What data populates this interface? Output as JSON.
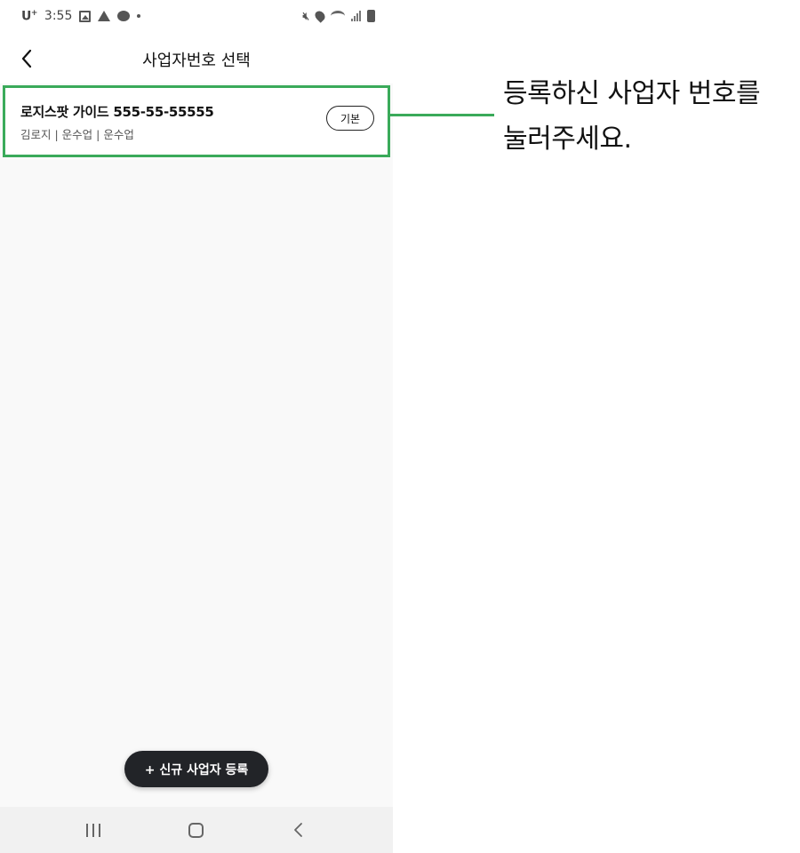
{
  "status_bar": {
    "carrier": "U",
    "carrier_sup": "+",
    "time": "3:55",
    "icons_left": [
      "gallery-icon",
      "warning-icon",
      "talk-icon",
      "dot-icon"
    ],
    "icons_right": [
      "mute-icon",
      "location-icon",
      "wifi-icon",
      "signal-icon",
      "battery-icon"
    ]
  },
  "header": {
    "back_icon": "chevron-left-icon",
    "title": "사업자번호 선택"
  },
  "business_list": [
    {
      "name": "로지스팟 가이드 555-55-55555",
      "details": "김로지 | 운수업 | 운수업",
      "badge": "기본"
    }
  ],
  "actions": {
    "add_label": "+ 신규 사업자 등록"
  },
  "nav_bar": {
    "icons": [
      "recent-apps-icon",
      "home-icon",
      "back-icon"
    ]
  },
  "callout": {
    "line1": "등록하신 사업자 번호를",
    "line2": "눌러주세요.",
    "color": "#3aaa5a"
  }
}
